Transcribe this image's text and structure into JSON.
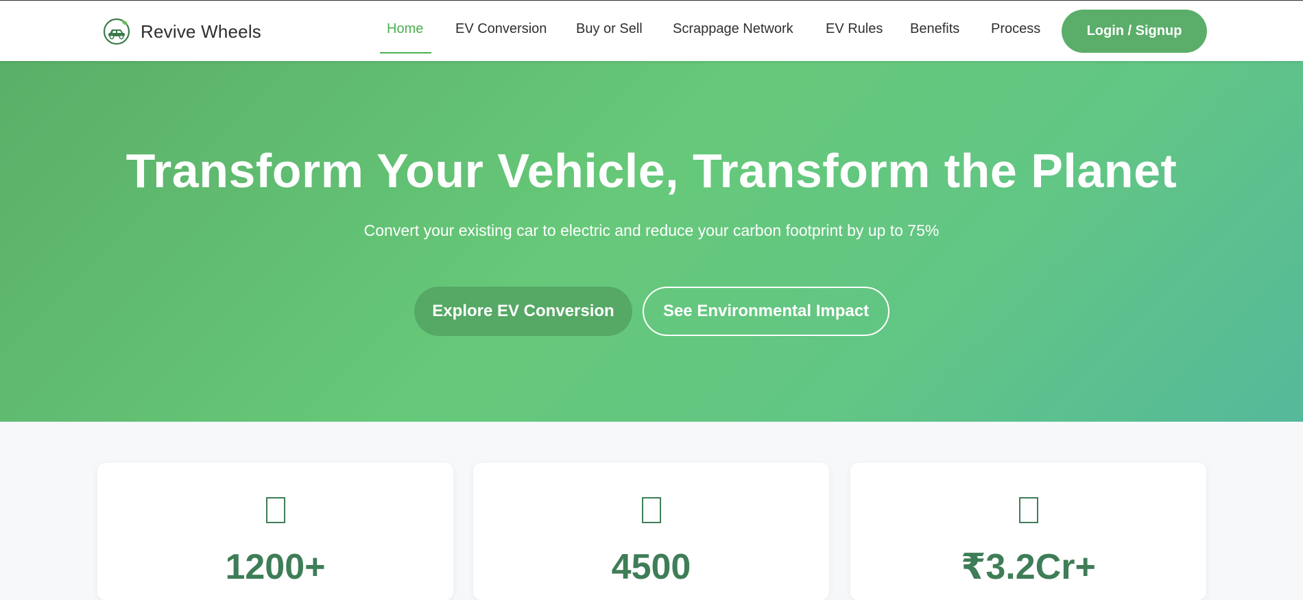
{
  "brand": {
    "name": "Revive Wheels",
    "logo_icon": "eco-car-icon"
  },
  "nav": {
    "items": [
      {
        "label": "Home",
        "active": true
      },
      {
        "label": "EV Conversion"
      },
      {
        "label": "Buy or Sell"
      },
      {
        "label": "Scrappage Network"
      },
      {
        "label": "EV Rules"
      },
      {
        "label": "Benefits"
      },
      {
        "label": "Process"
      }
    ],
    "login_label": "Login / Signup"
  },
  "hero": {
    "title": "Transform Your Vehicle, Transform the Planet",
    "subtitle": "Convert your existing car to electric and reduce your carbon footprint by up to 75%",
    "primary_cta": "Explore EV Conversion",
    "secondary_cta": "See Environmental Impact"
  },
  "stats": [
    {
      "value": "1200+",
      "icon": "missing-glyph-icon"
    },
    {
      "value": "4500",
      "icon": "missing-glyph-icon"
    },
    {
      "value": "₹3.2Cr+",
      "icon": "missing-glyph-icon"
    }
  ],
  "colors": {
    "accent": "#4caf50",
    "button_green": "#5bae6a",
    "stat_text": "#3e7d57",
    "hero_gradient_start": "#5aaf67",
    "hero_gradient_end": "#55b99b"
  }
}
